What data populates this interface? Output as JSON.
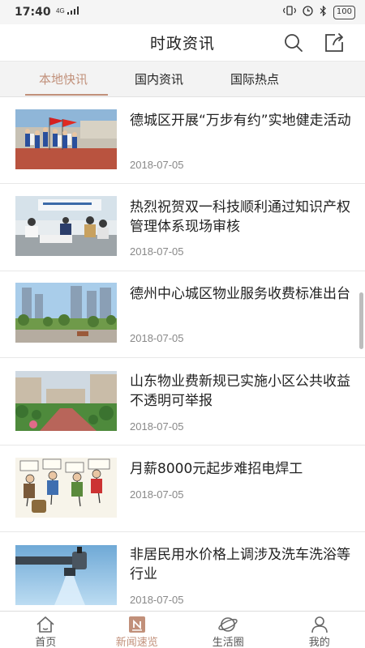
{
  "status_bar": {
    "time": "17:40",
    "network": "4G",
    "battery": "100"
  },
  "header": {
    "title": "时政资讯"
  },
  "tabs": [
    {
      "label": "本地快讯",
      "active": true
    },
    {
      "label": "国内资讯",
      "active": false
    },
    {
      "label": "国际热点",
      "active": false
    }
  ],
  "news": [
    {
      "title": "德城区开展“万步有约”实地健走活动",
      "date": "2018-07-05"
    },
    {
      "title": "热烈祝贺双一科技顺利通过知识产权管理体系现场审核",
      "date": "2018-07-05"
    },
    {
      "title": "德州中心城区物业服务收费标准出台",
      "date": "2018-07-05"
    },
    {
      "title": "山东物业费新规已实施小区公共收益不透明可举报",
      "date": "2018-07-05"
    },
    {
      "title": "月薪8000元起步难招电焊工",
      "date": "2018-07-05"
    },
    {
      "title": "非居民用水价格上调涉及洗车洗浴等行业",
      "date": "2018-07-05"
    }
  ],
  "bottom_nav": [
    {
      "label": "首页",
      "icon": "home-icon",
      "active": false
    },
    {
      "label": "新闻速览",
      "icon": "news-icon",
      "active": true
    },
    {
      "label": "生活圈",
      "icon": "planet-icon",
      "active": false
    },
    {
      "label": "我的",
      "icon": "user-icon",
      "active": false
    }
  ],
  "colors": {
    "accent": "#c1907a",
    "tab_bg": "#f3f3f3"
  }
}
